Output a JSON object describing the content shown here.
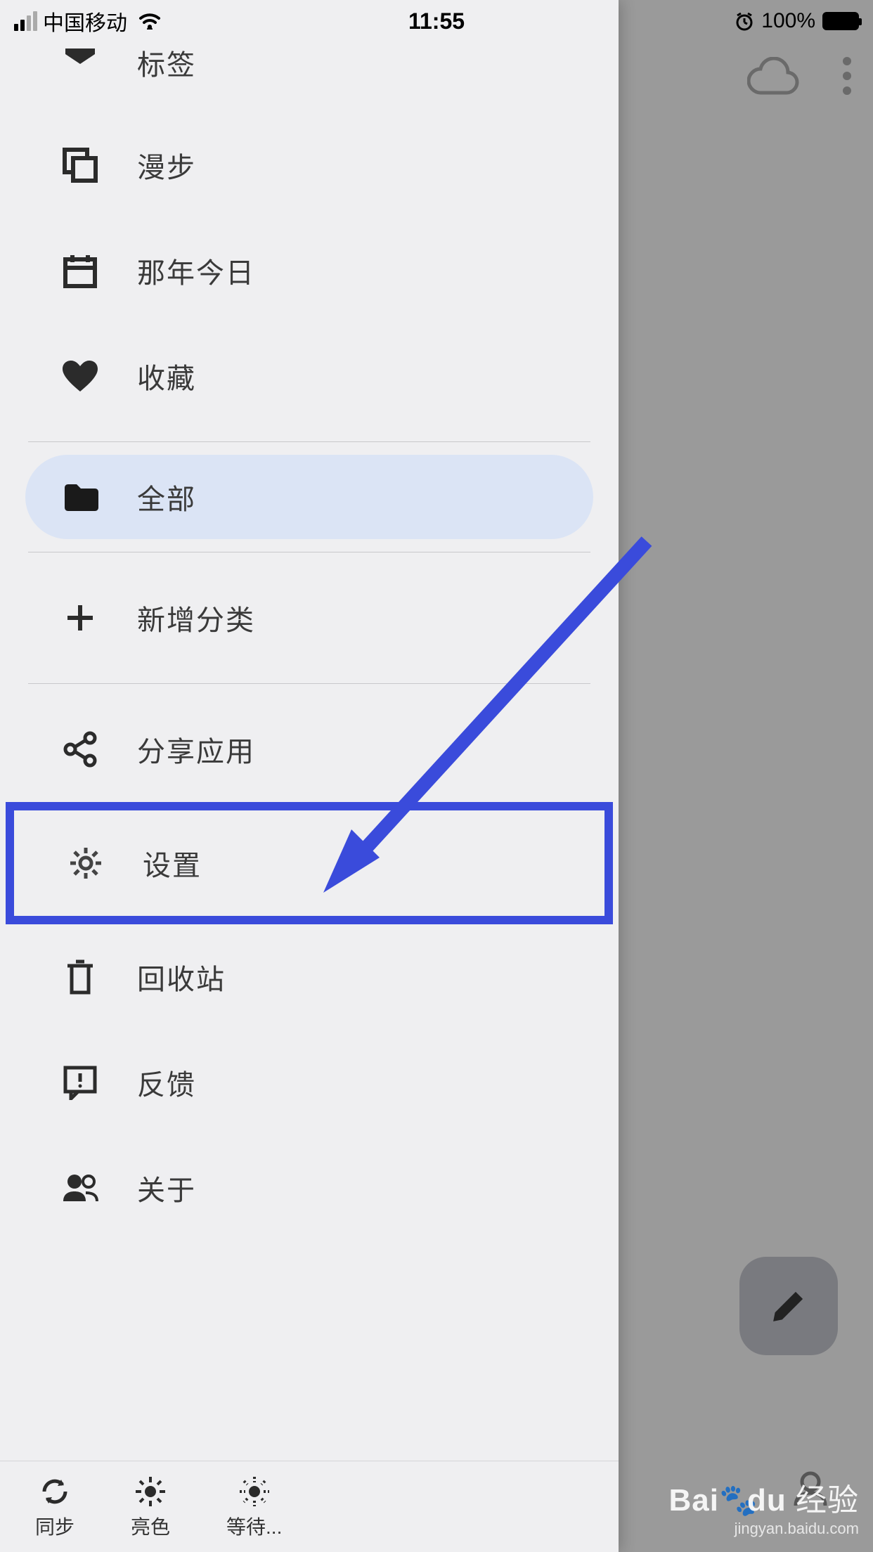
{
  "status": {
    "carrier": "中国移动",
    "time": "11:55",
    "battery_pct": "100%"
  },
  "drawer": {
    "items": {
      "partial": {
        "label": "标签"
      },
      "walk": {
        "label": "漫步"
      },
      "thatday": {
        "label": "那年今日"
      },
      "favorite": {
        "label": "收藏"
      },
      "all": {
        "label": "全部"
      },
      "addcat": {
        "label": "新增分类"
      },
      "share": {
        "label": "分享应用"
      },
      "settings": {
        "label": "设置"
      },
      "recycle": {
        "label": "回收站"
      },
      "feedback": {
        "label": "反馈"
      },
      "about": {
        "label": "关于"
      }
    },
    "bottom": {
      "sync": {
        "label": "同步"
      },
      "theme": {
        "label": "亮色"
      },
      "wait": {
        "label": "等待..."
      }
    }
  },
  "watermark": {
    "logo_left": "Bai",
    "logo_mid": "du",
    "logo_right": "经验",
    "url": "jingyan.baidu.com"
  }
}
